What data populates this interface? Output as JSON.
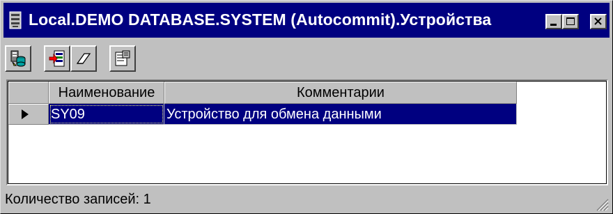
{
  "window": {
    "title": "Local.DEMO DATABASE.SYSTEM (Autocommit).Устройства",
    "colors": {
      "titlebar": "#000080",
      "face": "#c0c0c0",
      "selection": "#000080"
    }
  },
  "toolbar": {
    "buttons": [
      {
        "icon": "database-filter-icon"
      },
      {
        "icon": "insert-record-icon"
      },
      {
        "icon": "eraser-icon"
      },
      {
        "icon": "properties-icon"
      }
    ]
  },
  "grid": {
    "columns": [
      "Наименование",
      "Комментарии"
    ],
    "rows": [
      {
        "current": true,
        "cells": [
          "SY09",
          "Устройство для обмена данными"
        ]
      }
    ]
  },
  "status": {
    "text": "Количество записей: 1"
  }
}
